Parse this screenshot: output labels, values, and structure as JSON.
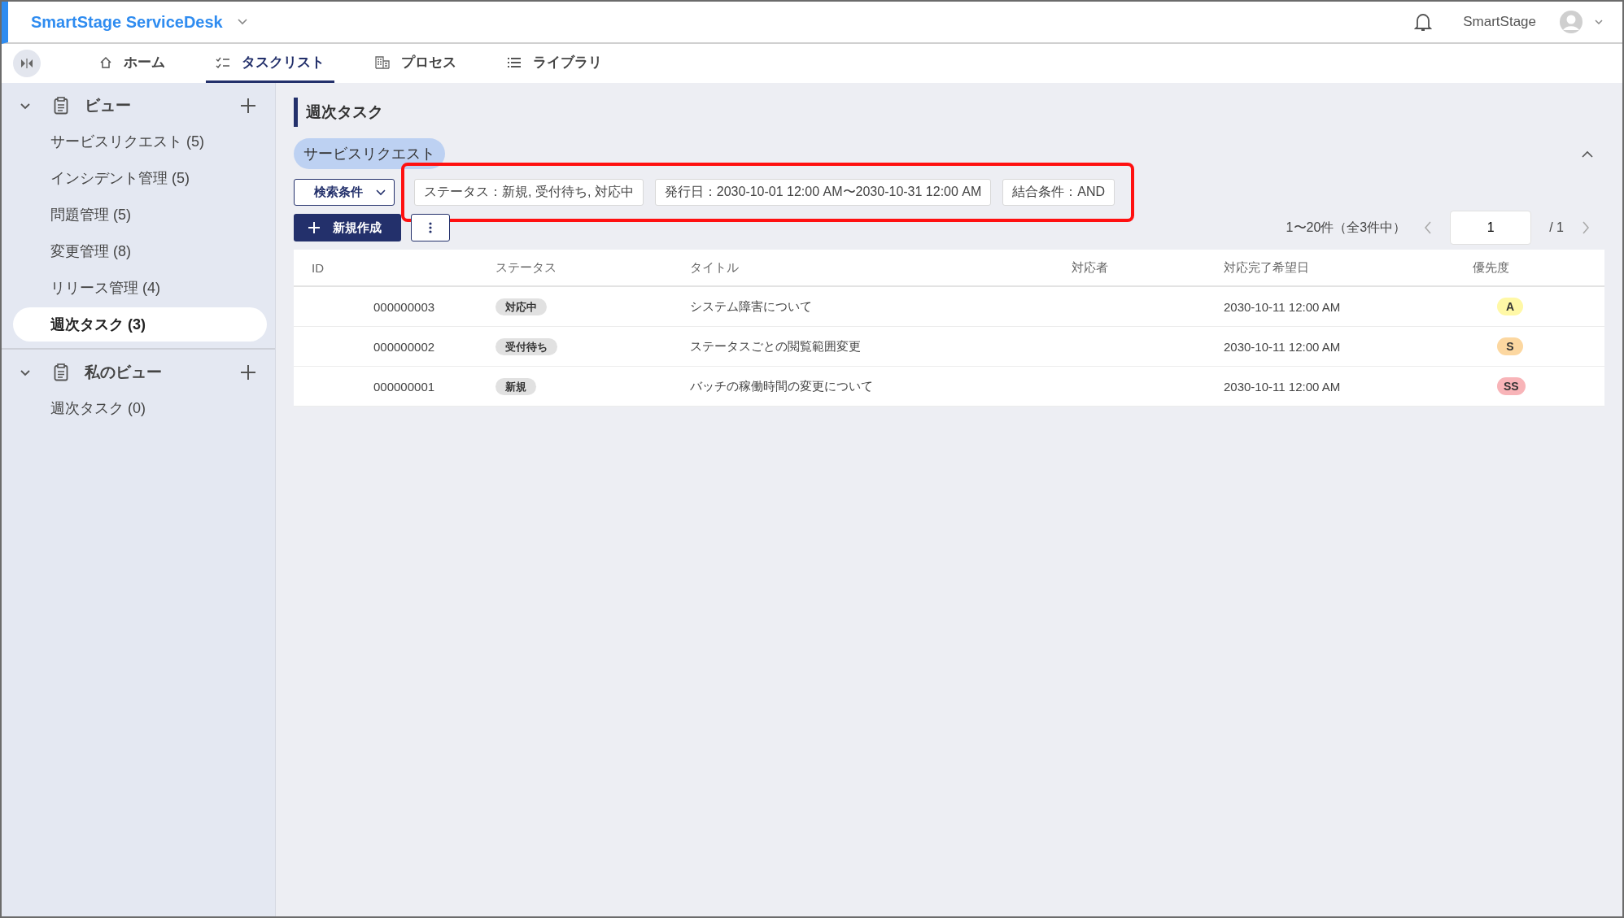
{
  "app": {
    "title": "SmartStage ServiceDesk",
    "user": "SmartStage"
  },
  "tabs": [
    {
      "label": "ホーム",
      "kind": "home",
      "selected": false
    },
    {
      "label": "タスクリスト",
      "kind": "tasks",
      "selected": true
    },
    {
      "label": "プロセス",
      "kind": "process",
      "selected": false
    },
    {
      "label": "ライブラリ",
      "kind": "library",
      "selected": false
    }
  ],
  "sidebar": {
    "sections": [
      {
        "label": "ビュー",
        "expanded": true,
        "items": [
          {
            "label": "サービスリクエスト (5)",
            "selected": false
          },
          {
            "label": "インシデント管理 (5)",
            "selected": false
          },
          {
            "label": "問題管理 (5)",
            "selected": false
          },
          {
            "label": "変更管理 (8)",
            "selected": false
          },
          {
            "label": "リリース管理 (4)",
            "selected": false
          },
          {
            "label": "週次タスク (3)",
            "selected": true
          }
        ]
      },
      {
        "label": "私のビュー",
        "expanded": true,
        "items": [
          {
            "label": "週次タスク (0)",
            "selected": false
          }
        ]
      }
    ]
  },
  "page": {
    "title": "週次タスク",
    "category": "サービスリクエスト",
    "search_button": "検索条件",
    "filters": [
      "ステータス：新規, 受付待ち, 対応中",
      "発行日：2030-10-01 12:00 AM〜2030-10-31 12:00 AM",
      "結合条件：AND"
    ],
    "new_button": "新規作成",
    "pagination": {
      "range": "1〜20件（全3件中）",
      "page": "1",
      "total": "/ 1"
    }
  },
  "table": {
    "columns": [
      "ID",
      "ステータス",
      "タイトル",
      "対応者",
      "対応完了希望日",
      "優先度"
    ],
    "rows": [
      {
        "id": "000000003",
        "status": "対応中",
        "title": "システム障害について",
        "due": "2030-10-11 12:00 AM",
        "priority": "A",
        "color": "#fff8a6"
      },
      {
        "id": "000000002",
        "status": "受付待ち",
        "title": "ステータスごとの閲覧範囲変更",
        "due": "2030-10-11 12:00 AM",
        "priority": "S",
        "color": "#fcd7a0"
      },
      {
        "id": "000000001",
        "status": "新規",
        "title": "バッチの稼働時間の変更について",
        "due": "2030-10-11 12:00 AM",
        "priority": "SS",
        "color": "#f8b4b8"
      }
    ]
  }
}
